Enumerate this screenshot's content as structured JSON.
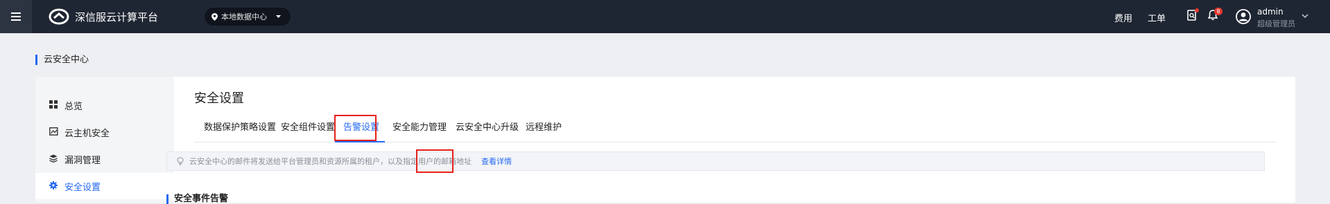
{
  "header": {
    "brand": "深信服云计算平台",
    "region": "本地数据中心",
    "links": {
      "billing": "费用",
      "tickets": "工单"
    },
    "notification_count": "8",
    "user": {
      "name": "admin",
      "role": "超级管理员"
    }
  },
  "breadcrumb": "云安全中心",
  "sidebar": {
    "items": [
      {
        "label": "总览",
        "icon": "grid-icon"
      },
      {
        "label": "云主机安全",
        "icon": "host-icon"
      },
      {
        "label": "漏洞管理",
        "icon": "layers-icon"
      },
      {
        "label": "安全设置",
        "icon": "gear-icon",
        "active": true
      }
    ]
  },
  "main": {
    "title": "安全设置",
    "tabs": [
      {
        "label": "数据保护策略设置"
      },
      {
        "label": "安全组件设置"
      },
      {
        "label": "告警设置",
        "active": true
      },
      {
        "label": "安全能力管理"
      },
      {
        "label": "云安全中心升级"
      },
      {
        "label": "远程维护"
      }
    ],
    "notice": {
      "text": "云安全中心的邮件将发送给平台管理员和资源所属的租户，以及指定用户的邮箱地址",
      "link": "查看详情"
    },
    "section_title": "安全事件告警"
  },
  "colors": {
    "accent": "#2468f2",
    "topbar": "#1f2633",
    "highlight": "#e5201b"
  }
}
